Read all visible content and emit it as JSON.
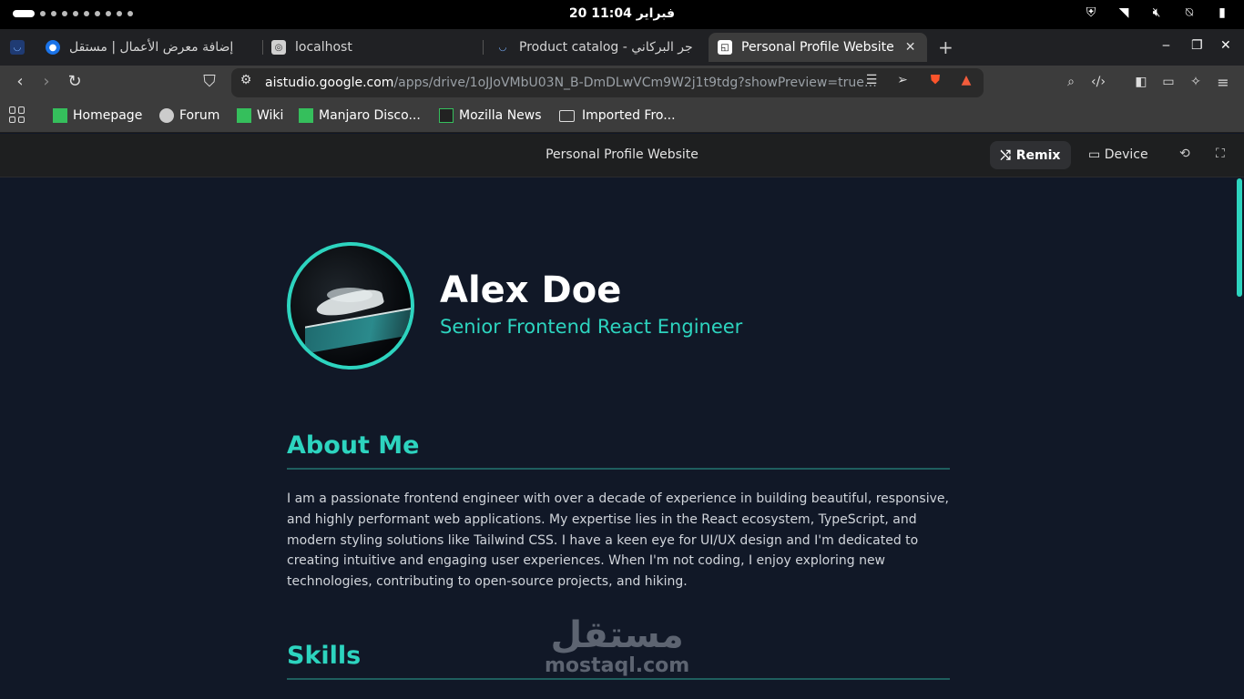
{
  "status_bar": {
    "clock": "20 فبراير 11:04",
    "icons": [
      "shield-icon",
      "wifi-icon",
      "mute-icon",
      "bell-off-icon",
      "battery-icon"
    ]
  },
  "tabs": [
    {
      "label": "إضافة معرض الأعمال | مستقل",
      "active": false
    },
    {
      "label": "localhost",
      "active": false
    },
    {
      "label": "Product catalog - جر البركاني",
      "active": false
    },
    {
      "label": "Personal Profile Website",
      "active": true
    }
  ],
  "toolbar": {
    "url_host": "aistudio.google.com",
    "url_path": "/apps/drive/1oJJoVMbU03N_B-DmDLwVCm9W2j1t9tdg?showPreview=true…"
  },
  "bookmarks": [
    "Homepage",
    "Forum",
    "Wiki",
    "Manjaro Disco...",
    "Mozilla News",
    "Imported Fro..."
  ],
  "studio": {
    "title": "Personal Profile Website",
    "remix_label": "Remix",
    "device_label": "Device"
  },
  "profile": {
    "name": "Alex Doe",
    "role": "Senior Frontend React Engineer",
    "about_title": "About Me",
    "about_text": "I am a passionate frontend engineer with over a decade of experience in building beautiful, responsive, and highly performant web applications. My expertise lies in the React ecosystem, TypeScript, and modern styling solutions like Tailwind CSS. I have a keen eye for UI/UX design and I'm dedicated to creating intuitive and engaging user experiences. When I'm not coding, I enjoy exploring new technologies, contributing to open-source projects, and hiking.",
    "skills_title": "Skills"
  },
  "watermark": {
    "arabic": "مستقل",
    "latin": "mostaql.com"
  },
  "colors": {
    "accent": "#2dd4bf",
    "page_bg": "#111827"
  }
}
